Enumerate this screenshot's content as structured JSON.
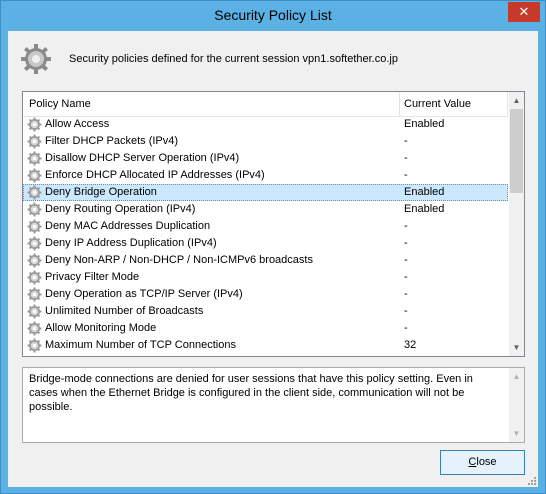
{
  "window": {
    "title": "Security Policy List",
    "close_glyph": "✕"
  },
  "header": {
    "icon": "gear-icon",
    "text": "Security policies defined for the current session vpn1.softether.co.jp"
  },
  "list": {
    "columns": [
      "Policy Name",
      "Current Value"
    ],
    "rows": [
      {
        "name": "Allow Access",
        "value": "Enabled",
        "selected": false
      },
      {
        "name": "Filter DHCP Packets (IPv4)",
        "value": "-",
        "selected": false
      },
      {
        "name": "Disallow DHCP Server Operation (IPv4)",
        "value": "-",
        "selected": false
      },
      {
        "name": "Enforce DHCP Allocated IP Addresses (IPv4)",
        "value": "-",
        "selected": false
      },
      {
        "name": "Deny Bridge Operation",
        "value": "Enabled",
        "selected": true
      },
      {
        "name": "Deny Routing Operation (IPv4)",
        "value": "Enabled",
        "selected": false
      },
      {
        "name": "Deny MAC Addresses Duplication",
        "value": "-",
        "selected": false
      },
      {
        "name": "Deny IP Address Duplication (IPv4)",
        "value": "-",
        "selected": false
      },
      {
        "name": "Deny Non-ARP / Non-DHCP / Non-ICMPv6 broadcasts",
        "value": "-",
        "selected": false
      },
      {
        "name": "Privacy Filter Mode",
        "value": "-",
        "selected": false
      },
      {
        "name": "Deny Operation as TCP/IP Server (IPv4)",
        "value": "-",
        "selected": false
      },
      {
        "name": "Unlimited Number of Broadcasts",
        "value": "-",
        "selected": false
      },
      {
        "name": "Allow Monitoring Mode",
        "value": "-",
        "selected": false
      },
      {
        "name": "Maximum Number of TCP Connections",
        "value": "32",
        "selected": false
      }
    ],
    "row_icon": "gear-icon"
  },
  "description": {
    "text": "Bridge-mode connections are denied for user sessions that have this policy setting. Even in cases when the Ethernet Bridge is configured in the client side, communication will not be possible."
  },
  "buttons": {
    "close_access_key": "C",
    "close_rest": "lose"
  },
  "colors": {
    "title_bar": "#5bb1e3",
    "close_red": "#c7392b",
    "selection": "#cce8ff"
  }
}
